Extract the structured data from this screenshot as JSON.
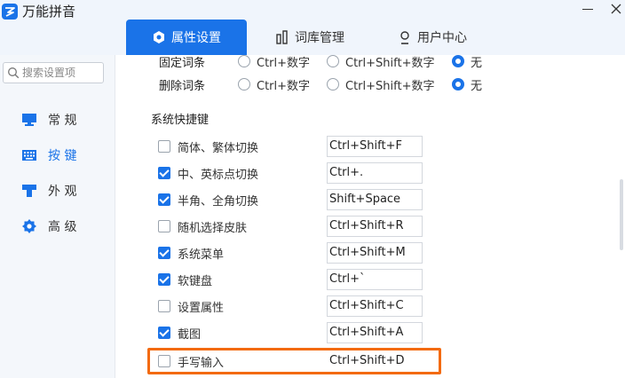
{
  "app": {
    "title": "万能拼音"
  },
  "tabs": [
    {
      "label": "属性设置",
      "active": true
    },
    {
      "label": "词库管理",
      "active": false
    },
    {
      "label": "用户中心",
      "active": false
    }
  ],
  "sidebar": {
    "search_placeholder": "搜索设置项",
    "items": [
      {
        "label": "常 规",
        "icon": "monitor-icon",
        "active": false
      },
      {
        "label": "按 键",
        "icon": "keyboard-icon",
        "active": true
      },
      {
        "label": "外 观",
        "icon": "brush-icon",
        "active": false
      },
      {
        "label": "高 级",
        "icon": "gear-icon",
        "active": false
      }
    ]
  },
  "word_options": [
    {
      "label": "固定词条",
      "options": [
        "Ctrl+数字",
        "Ctrl+Shift+数字",
        "无"
      ],
      "selected": "无"
    },
    {
      "label": "删除词条",
      "options": [
        "Ctrl+数字",
        "Ctrl+Shift+数字",
        "无"
      ],
      "selected": "无"
    }
  ],
  "hotkeys": {
    "title": "系统快捷键",
    "items": [
      {
        "label": "简体、繁体切换",
        "checked": false,
        "value": "Ctrl+Shift+F"
      },
      {
        "label": "中、英标点切换",
        "checked": true,
        "value": "Ctrl+."
      },
      {
        "label": "半角、全角切换",
        "checked": true,
        "value": "Shift+Space"
      },
      {
        "label": "随机选择皮肤",
        "checked": false,
        "value": "Ctrl+Shift+R"
      },
      {
        "label": "系统菜单",
        "checked": true,
        "value": "Ctrl+Shift+M"
      },
      {
        "label": "软键盘",
        "checked": true,
        "value": "Ctrl+`"
      },
      {
        "label": "设置属性",
        "checked": false,
        "value": "Ctrl+Shift+C"
      },
      {
        "label": "截图",
        "checked": true,
        "value": "Ctrl+Shift+A"
      },
      {
        "label": "手写输入",
        "checked": false,
        "value": "Ctrl+Shift+D"
      }
    ]
  },
  "colors": {
    "accent": "#1a73e8",
    "highlight": "#f36a10",
    "titlebar_bg": "#f0f5fc",
    "sidebar_bg": "#f4f7fb"
  }
}
